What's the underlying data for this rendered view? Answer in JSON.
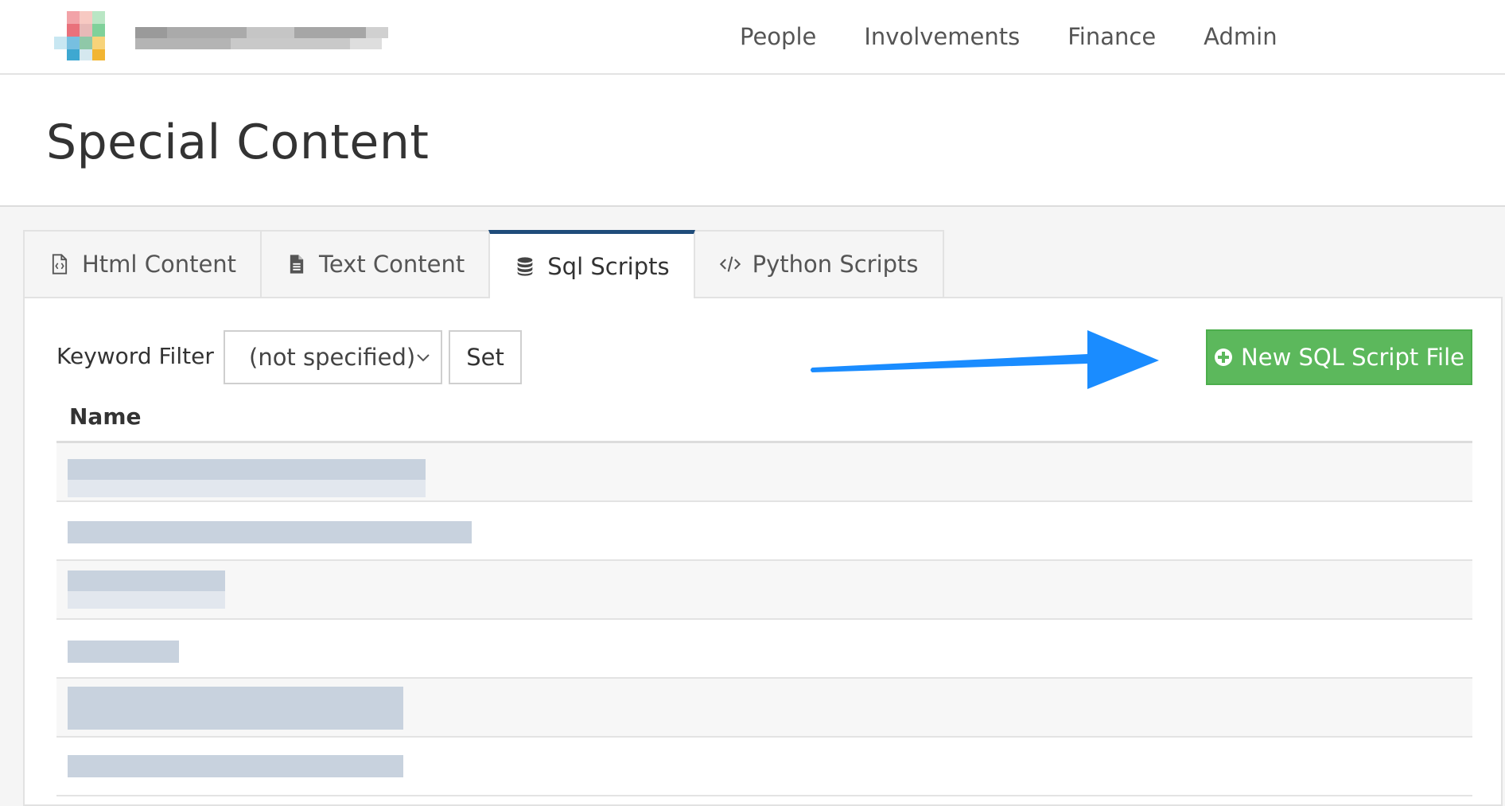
{
  "nav": {
    "links": [
      "People",
      "Involvements",
      "Finance",
      "Admin"
    ]
  },
  "page": {
    "title": "Special Content"
  },
  "tabs": [
    {
      "label": "Html Content",
      "icon": "html-file-icon",
      "active": false
    },
    {
      "label": "Text Content",
      "icon": "text-file-icon",
      "active": false
    },
    {
      "label": "Sql Scripts",
      "icon": "database-icon",
      "active": true
    },
    {
      "label": "Python Scripts",
      "icon": "code-icon",
      "active": false
    }
  ],
  "filter": {
    "label": "Keyword Filter",
    "selected": "(not specified)",
    "set_label": "Set"
  },
  "actions": {
    "new_label": "New SQL Script File"
  },
  "table": {
    "header": "Name"
  },
  "colors": {
    "accent": "#1f4c7a",
    "success": "#5cb85c",
    "annotation_arrow": "#1a8cff"
  }
}
